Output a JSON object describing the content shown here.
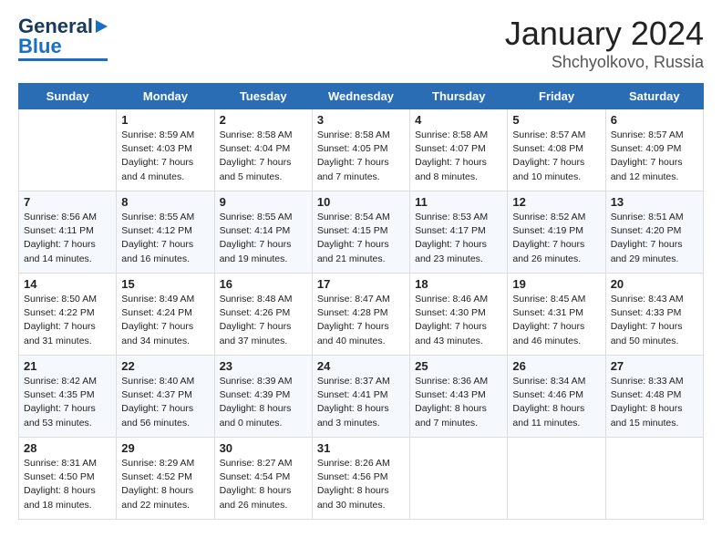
{
  "header": {
    "logo_general": "General",
    "logo_blue": "Blue",
    "month": "January 2024",
    "location": "Shchyolkovo, Russia"
  },
  "weekdays": [
    "Sunday",
    "Monday",
    "Tuesday",
    "Wednesday",
    "Thursday",
    "Friday",
    "Saturday"
  ],
  "weeks": [
    [
      {
        "day": "",
        "empty": true
      },
      {
        "day": "1",
        "sunrise": "8:59 AM",
        "sunset": "4:03 PM",
        "daylight": "7 hours and 4 minutes."
      },
      {
        "day": "2",
        "sunrise": "8:58 AM",
        "sunset": "4:04 PM",
        "daylight": "7 hours and 5 minutes."
      },
      {
        "day": "3",
        "sunrise": "8:58 AM",
        "sunset": "4:05 PM",
        "daylight": "7 hours and 7 minutes."
      },
      {
        "day": "4",
        "sunrise": "8:58 AM",
        "sunset": "4:07 PM",
        "daylight": "7 hours and 8 minutes."
      },
      {
        "day": "5",
        "sunrise": "8:57 AM",
        "sunset": "4:08 PM",
        "daylight": "7 hours and 10 minutes."
      },
      {
        "day": "6",
        "sunrise": "8:57 AM",
        "sunset": "4:09 PM",
        "daylight": "7 hours and 12 minutes."
      }
    ],
    [
      {
        "day": "7",
        "sunrise": "8:56 AM",
        "sunset": "4:11 PM",
        "daylight": "7 hours and 14 minutes."
      },
      {
        "day": "8",
        "sunrise": "8:55 AM",
        "sunset": "4:12 PM",
        "daylight": "7 hours and 16 minutes."
      },
      {
        "day": "9",
        "sunrise": "8:55 AM",
        "sunset": "4:14 PM",
        "daylight": "7 hours and 19 minutes."
      },
      {
        "day": "10",
        "sunrise": "8:54 AM",
        "sunset": "4:15 PM",
        "daylight": "7 hours and 21 minutes."
      },
      {
        "day": "11",
        "sunrise": "8:53 AM",
        "sunset": "4:17 PM",
        "daylight": "7 hours and 23 minutes."
      },
      {
        "day": "12",
        "sunrise": "8:52 AM",
        "sunset": "4:19 PM",
        "daylight": "7 hours and 26 minutes."
      },
      {
        "day": "13",
        "sunrise": "8:51 AM",
        "sunset": "4:20 PM",
        "daylight": "7 hours and 29 minutes."
      }
    ],
    [
      {
        "day": "14",
        "sunrise": "8:50 AM",
        "sunset": "4:22 PM",
        "daylight": "7 hours and 31 minutes."
      },
      {
        "day": "15",
        "sunrise": "8:49 AM",
        "sunset": "4:24 PM",
        "daylight": "7 hours and 34 minutes."
      },
      {
        "day": "16",
        "sunrise": "8:48 AM",
        "sunset": "4:26 PM",
        "daylight": "7 hours and 37 minutes."
      },
      {
        "day": "17",
        "sunrise": "8:47 AM",
        "sunset": "4:28 PM",
        "daylight": "7 hours and 40 minutes."
      },
      {
        "day": "18",
        "sunrise": "8:46 AM",
        "sunset": "4:30 PM",
        "daylight": "7 hours and 43 minutes."
      },
      {
        "day": "19",
        "sunrise": "8:45 AM",
        "sunset": "4:31 PM",
        "daylight": "7 hours and 46 minutes."
      },
      {
        "day": "20",
        "sunrise": "8:43 AM",
        "sunset": "4:33 PM",
        "daylight": "7 hours and 50 minutes."
      }
    ],
    [
      {
        "day": "21",
        "sunrise": "8:42 AM",
        "sunset": "4:35 PM",
        "daylight": "7 hours and 53 minutes."
      },
      {
        "day": "22",
        "sunrise": "8:40 AM",
        "sunset": "4:37 PM",
        "daylight": "7 hours and 56 minutes."
      },
      {
        "day": "23",
        "sunrise": "8:39 AM",
        "sunset": "4:39 PM",
        "daylight": "8 hours and 0 minutes."
      },
      {
        "day": "24",
        "sunrise": "8:37 AM",
        "sunset": "4:41 PM",
        "daylight": "8 hours and 3 minutes."
      },
      {
        "day": "25",
        "sunrise": "8:36 AM",
        "sunset": "4:43 PM",
        "daylight": "8 hours and 7 minutes."
      },
      {
        "day": "26",
        "sunrise": "8:34 AM",
        "sunset": "4:46 PM",
        "daylight": "8 hours and 11 minutes."
      },
      {
        "day": "27",
        "sunrise": "8:33 AM",
        "sunset": "4:48 PM",
        "daylight": "8 hours and 15 minutes."
      }
    ],
    [
      {
        "day": "28",
        "sunrise": "8:31 AM",
        "sunset": "4:50 PM",
        "daylight": "8 hours and 18 minutes."
      },
      {
        "day": "29",
        "sunrise": "8:29 AM",
        "sunset": "4:52 PM",
        "daylight": "8 hours and 22 minutes."
      },
      {
        "day": "30",
        "sunrise": "8:27 AM",
        "sunset": "4:54 PM",
        "daylight": "8 hours and 26 minutes."
      },
      {
        "day": "31",
        "sunrise": "8:26 AM",
        "sunset": "4:56 PM",
        "daylight": "8 hours and 30 minutes."
      },
      {
        "day": "",
        "empty": true
      },
      {
        "day": "",
        "empty": true
      },
      {
        "day": "",
        "empty": true
      }
    ]
  ],
  "labels": {
    "sunrise": "Sunrise:",
    "sunset": "Sunset:",
    "daylight": "Daylight:"
  }
}
